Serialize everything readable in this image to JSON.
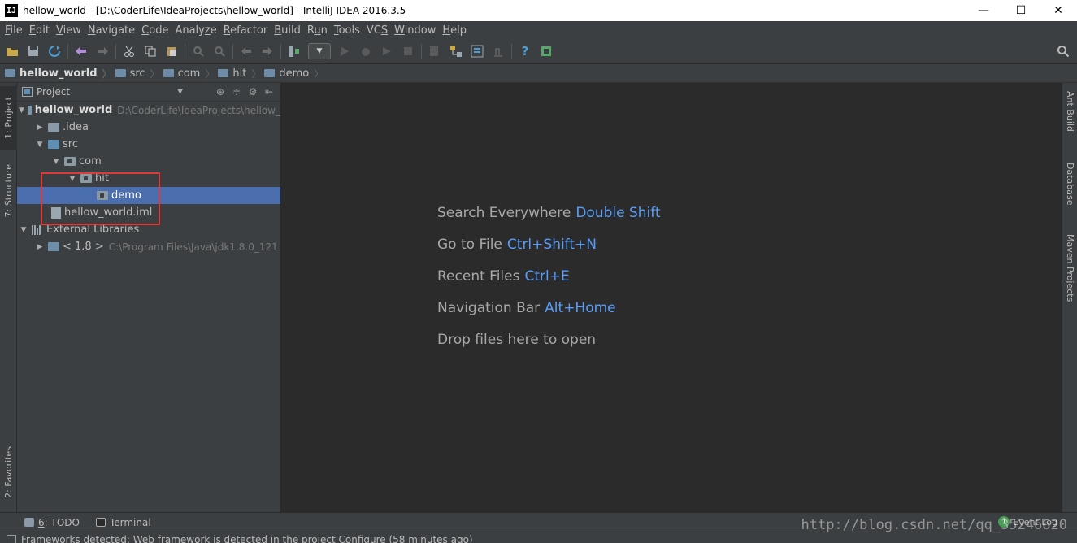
{
  "window": {
    "app_icon": "IJ",
    "title": "hellow_world - [D:\\CoderLife\\IdeaProjects\\hellow_world] - IntelliJ IDEA 2016.3.5",
    "minimize": "—",
    "maximize": "☐",
    "close": "✕"
  },
  "menu": [
    {
      "label": "File",
      "mnemonic": "F"
    },
    {
      "label": "Edit",
      "mnemonic": "E"
    },
    {
      "label": "View",
      "mnemonic": "V"
    },
    {
      "label": "Navigate",
      "mnemonic": "N"
    },
    {
      "label": "Code",
      "mnemonic": "C"
    },
    {
      "label": "Analyze",
      "mnemonic": "z"
    },
    {
      "label": "Refactor",
      "mnemonic": "R"
    },
    {
      "label": "Build",
      "mnemonic": "B"
    },
    {
      "label": "Run",
      "mnemonic": "u"
    },
    {
      "label": "Tools",
      "mnemonic": "T"
    },
    {
      "label": "VCS",
      "mnemonic": "S"
    },
    {
      "label": "Window",
      "mnemonic": "W"
    },
    {
      "label": "Help",
      "mnemonic": "H"
    }
  ],
  "toolbar": {
    "icons": [
      "open-icon",
      "save-icon",
      "sync-icon",
      "undo-icon",
      "redo-icon",
      "cut-icon",
      "copy-icon",
      "paste-icon",
      "find-icon",
      "replace-icon",
      "back-icon",
      "forward-icon",
      "make-icon",
      "run-config-dropdown",
      "run-icon",
      "debug-icon",
      "coverage-icon",
      "stop-icon",
      "build-artifacts-icon",
      "project-structure-icon",
      "settings-icon",
      "sdk-icon",
      "help-icon",
      "plugin-icon"
    ],
    "dropdown_caret": "▼"
  },
  "breadcrumb": [
    {
      "label": "hellow_world",
      "bold": true
    },
    {
      "label": "src"
    },
    {
      "label": "com"
    },
    {
      "label": "hit"
    },
    {
      "label": "demo"
    }
  ],
  "left_tabs": {
    "project": "1: Project",
    "structure": "7: Structure",
    "favorites": "2: Favorites"
  },
  "right_tabs": {
    "ant": "Ant Build",
    "database": "Database",
    "maven": "Maven Projects"
  },
  "project_panel": {
    "title": "Project",
    "tree": {
      "root_name": "hellow_world",
      "root_path": "D:\\CoderLife\\IdeaProjects\\hellow_",
      "idea": ".idea",
      "src": "src",
      "com": "com",
      "hit": "hit",
      "demo": "demo",
      "iml": "hellow_world.iml",
      "ext_libs": "External Libraries",
      "jdk_name": "< 1.8 >",
      "jdk_path": "C:\\Program Files\\Java\\jdk1.8.0_121"
    }
  },
  "editor_hints": [
    {
      "text": "Search Everywhere",
      "key": "Double Shift"
    },
    {
      "text": "Go to File",
      "key": "Ctrl+Shift+N"
    },
    {
      "text": "Recent Files",
      "key": "Ctrl+E"
    },
    {
      "text": "Navigation Bar",
      "key": "Alt+Home"
    },
    {
      "text": "Drop files here to open",
      "key": ""
    }
  ],
  "bottom_tabs": {
    "todo_num": "6",
    "todo_label": ": TODO",
    "terminal": "Terminal",
    "event_count": "1",
    "event_log": "Event Log"
  },
  "status": {
    "message": "Frameworks detected: Web framework is detected in the project Configure (58 minutes ago)"
  },
  "watermark": "http://blog.csdn.net/qq_35246620"
}
